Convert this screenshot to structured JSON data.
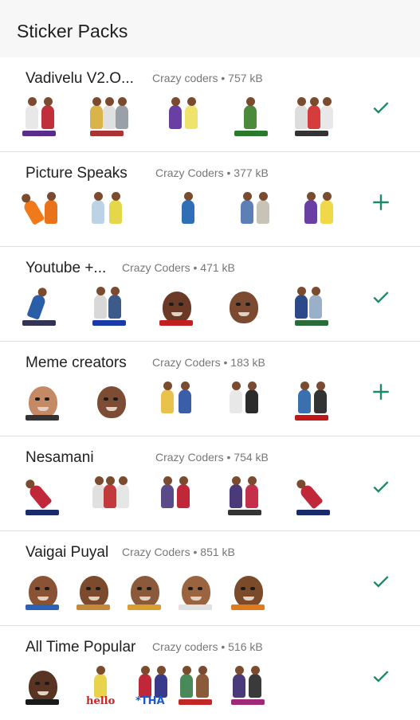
{
  "app": {
    "title": "Sticker Packs"
  },
  "colors": {
    "accent": "#1b8a6b"
  },
  "packs": [
    {
      "name": "Vadivelu V2.O...",
      "publisher": "Crazy coders",
      "size": "757 kB",
      "action": "added-check-icon"
    },
    {
      "name": "Picture Speaks",
      "publisher": "Crazy Coders",
      "size": "377 kB",
      "action": "add-plus-icon"
    },
    {
      "name": "Youtube +...",
      "publisher": "Crazy Coders",
      "size": "471 kB",
      "action": "added-check-icon"
    },
    {
      "name": "Meme creators",
      "publisher": "Crazy Coders",
      "size": "183 kB",
      "action": "add-plus-icon"
    },
    {
      "name": "Nesamani",
      "publisher": "Crazy Coders",
      "size": "754 kB",
      "action": "added-check-icon"
    },
    {
      "name": "Vaigai Puyal",
      "publisher": "Crazy Coders",
      "size": "851 kB",
      "action": "added-check-icon"
    },
    {
      "name": "All Time Popular",
      "publisher": "Crazy coders",
      "size": "516 kB",
      "action": "added-check-icon",
      "sticker_words": [
        "",
        "hello",
        "*THA",
        "",
        ""
      ]
    }
  ]
}
